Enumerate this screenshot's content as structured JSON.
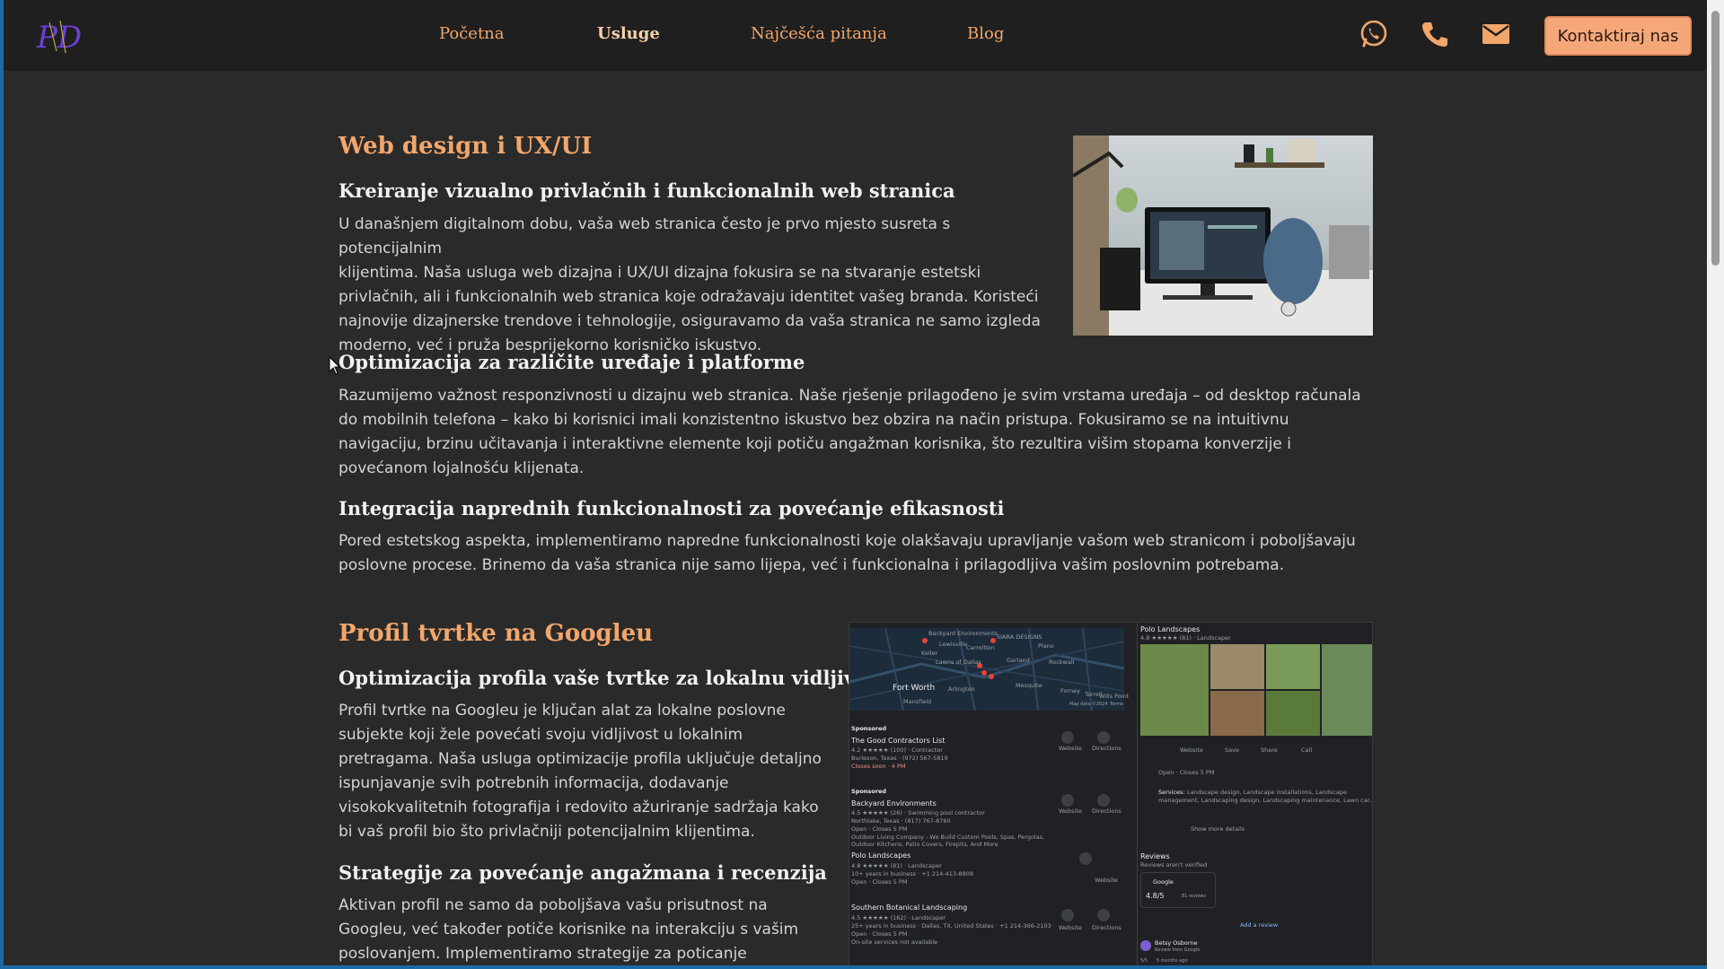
{
  "nav": {
    "logo_text": "PD",
    "links": [
      "Početna",
      "Usluge",
      "Najčešća pitanja",
      "Blog"
    ],
    "active": "Usluge",
    "cta_label": "Kontaktiraj nas"
  },
  "section1": {
    "title": "Web design i UX/UI",
    "sub1": "Kreiranje vizualno privlačnih i funkcionalnih web stranica",
    "p1_lines": [
      "U današnjem digitalnom dobu, vaša web stranica često je prvo mjesto susreta s potencijalnim",
      "klijentima. Naša usluga web dizajna i UX/UI dizajna fokusira se na stvaranje estetski",
      "privlačnih, ali i funkcionalnih web stranica koje odražavaju identitet vašeg branda. Koristeći",
      "najnovije dizajnerske trendove i tehnologije, osiguravamo da vaša stranica ne samo izgleda",
      "moderno, već i pruža besprijekorno korisničko iskustvo."
    ],
    "sub2": "Optimizacija za različite uređaje i platforme",
    "p2_lines": [
      "Razumijemo važnost responzivnosti u dizajnu web stranica. Naše rješenje prilagođeno je svim vrstama uređaja – od desktop računala",
      "do mobilnih telefona – kako bi korisnici imali konzistentno iskustvo bez obzira na način pristupa. Fokusiramo se na intuitivnu",
      "navigaciju, brzinu učitavanja i interaktivne elemente koji potiču angažman korisnika, što rezultira višim stopama konverzije i",
      "povećanom lojalnošću klijenata."
    ],
    "sub3": "Integracija naprednih funkcionalnosti za povećanje efikasnosti",
    "p3_lines": [
      "Pored estetskog aspekta, implementiramo napredne funkcionalnosti koje olakšavaju upravljanje vašom web stranicom i poboljšavaju",
      "poslovne procese. Brinemo da vaša stranica nije samo lijepa, već i funkcionalna i prilagodljiva vašim poslovnim potrebama."
    ]
  },
  "section2": {
    "title": "Profil tvrtke na Googleu",
    "sub1": "Optimizacija profila vaše tvrtke za lokalnu vidljivost",
    "p1_lines": [
      "Profil tvrtke na Googleu je ključan alat za lokalne poslovne",
      "subjekte koji žele povećati svoju vidljivost u lokalnim",
      "pretragama. Naša usluga optimizacije profila uključuje detaljno",
      "ispunjavanje svih potrebnih informacija, dodavanje",
      "visokokvalitetnih fotografija i redovito ažuriranje sadržaja kako",
      "bi vaš profil bio što privlačniji potencijalnim klijentima."
    ],
    "sub2": "Strategije za povećanje angažmana i recenzija",
    "p2_lines": [
      "Aktivan profil ne samo da poboljšava vašu prisutnost na",
      "Googleu, već također potiče korisnike na interakciju s vašim",
      "poslovanjem. Implementiramo strategije za poticanje"
    ]
  },
  "maps_shot": {
    "map_labels": [
      "Backyard Environments",
      "SIARA DESIGNS",
      "Carrollton",
      "Keller",
      "Plano",
      "Lewisville",
      "Lawns of Dallas",
      "Garland",
      "Fort Worth",
      "Arlington",
      "Rockwall",
      "Mesquite",
      "Forney",
      "Terrell",
      "Wills Point",
      "Mansfield",
      "Map data ©2024",
      "Terms"
    ],
    "listings": [
      {
        "tag": "Sponsored",
        "name": "The Good Contractors List",
        "rating": "4.2 ★★★★★ (100) · Contractor",
        "l2": "Burleson, Texas · (972) 567-5819",
        "l3": "Closes soon · 4 PM"
      },
      {
        "tag": "Sponsored",
        "name": "Backyard Environments",
        "rating": "4.5 ★★★★★ (26) · Swimming pool contractor",
        "l2": "Northlake, Texas · (817) 767-8760",
        "l3": "Open · Closes 5 PM",
        "l4": "Outdoor Living Company - We Build Custom Pools, Spas, Pergolas,",
        "l5": "Outdoor Kitchens, Patio Covers, Firepits, And More"
      },
      {
        "tag": "",
        "name": "Polo Landscapes",
        "rating": "4.8 ★★★★★ (81) · Landscaper",
        "l2": "10+ years in business · +1 214-413-8808",
        "l3": "Open · Closes 5 PM"
      },
      {
        "tag": "",
        "name": "Southern Botanical Landscaping",
        "rating": "4.5 ★★★★★ (162) · Landscaper",
        "l2": "25+ years in business · Dallas, TX, United States · +1 214-366-2103",
        "l3": "Open · Closes 5 PM",
        "l4": "On-site services not available"
      }
    ],
    "website_label": "Website",
    "directions_label": "Directions",
    "panel": {
      "name": "Polo Landscapes",
      "rating": "4.8 ★★★★★ (81) · Landscaper",
      "actions": [
        "Website",
        "Save",
        "Share",
        "Call"
      ],
      "hours": "Open · Closes 5 PM",
      "services_label": "Services:",
      "services": "Landscape design, Landscape installations, Landscape",
      "services2": "management, Landscaping design, Landscaping maintenance, Lawn car...",
      "show_more": "Show more details",
      "reviews_title": "Reviews",
      "reviews_note": "Reviews aren't verified",
      "google_label": "Google",
      "score": "4.8/5",
      "count": "81 reviews",
      "add_review": "Add a review",
      "reviewer": "Betsy Osborne",
      "reviewer_sub": "Review from Google",
      "review_time": "5 months ago",
      "review_stars": "5/5"
    }
  },
  "colors": {
    "accent": "#f2a66a",
    "cta": "#f6a77a",
    "bg": "#2a2a2a",
    "header": "#1f1f1f"
  }
}
